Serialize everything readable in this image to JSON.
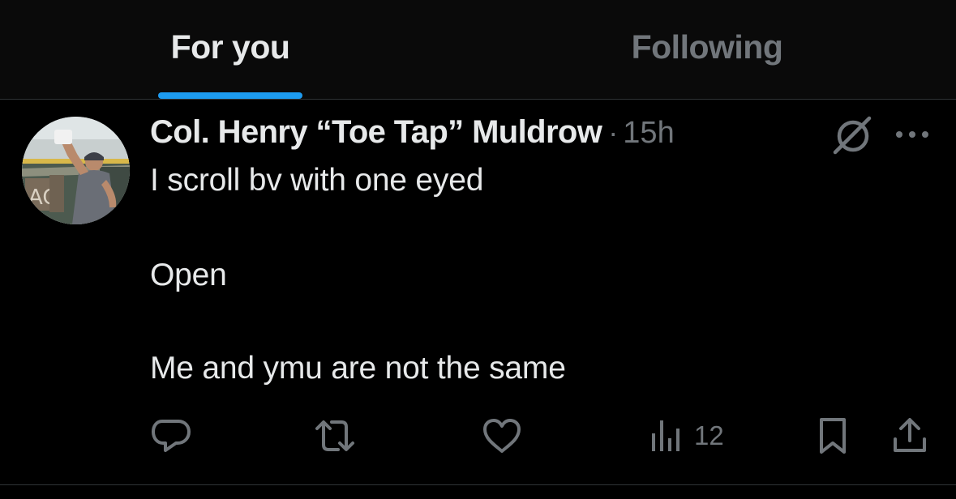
{
  "tabs": {
    "for_you": "For you",
    "following": "Following"
  },
  "post": {
    "author_name": "Col. Henry “Toe Tap” Muldrow",
    "separator": "·",
    "timestamp": "15h",
    "lines": [
      "I scroll bv with one eyed",
      "Open",
      "Me and ymu are not the same"
    ],
    "views_count": "12"
  },
  "icons": {
    "avatar": "avatar-photo",
    "grok": "grok-icon",
    "more": "more-options-icon",
    "reply": "reply-icon",
    "repost": "repost-icon",
    "like": "heart-icon",
    "views": "bar-chart-icon",
    "bookmark": "bookmark-icon",
    "share": "share-icon"
  },
  "colors": {
    "background": "#000000",
    "tab_bar": "#0a0a0a",
    "primary_text": "#e7e9ea",
    "secondary_text": "#71767b",
    "accent": "#1d9bf0",
    "divider": "#2f3336"
  }
}
